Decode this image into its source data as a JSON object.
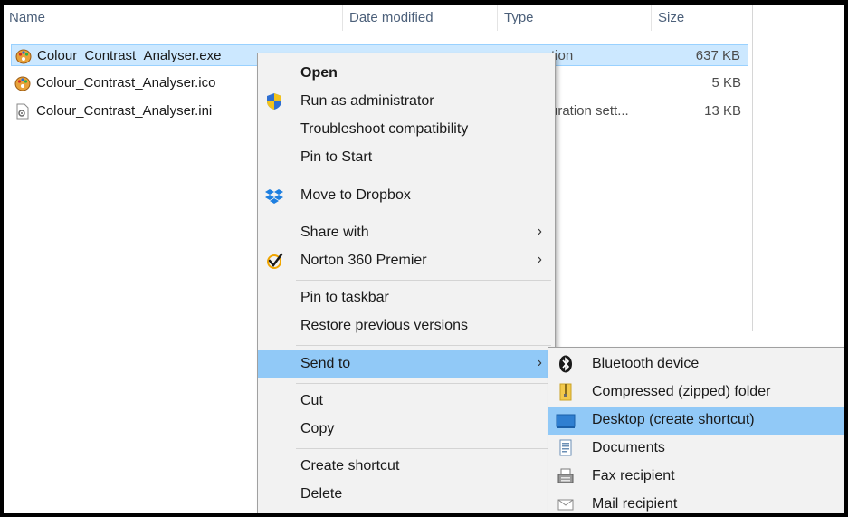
{
  "columns": {
    "name": "Name",
    "date_modified": "Date modified",
    "type": "Type",
    "size": "Size"
  },
  "files": [
    {
      "name": "Colour_Contrast_Analyser.exe",
      "type": "tion",
      "size": "637 KB",
      "icon": "app-palette-icon",
      "selected": true
    },
    {
      "name": "Colour_Contrast_Analyser.ico",
      "type": "",
      "size": "5 KB",
      "icon": "palette-icon",
      "selected": false
    },
    {
      "name": "Colour_Contrast_Analyser.ini",
      "type": "uration sett...",
      "size": "13 KB",
      "icon": "settings-file-icon",
      "selected": false
    }
  ],
  "context_menu": {
    "open": "Open",
    "run_as_admin": "Run as administrator",
    "troubleshoot": "Troubleshoot compatibility",
    "pin_start": "Pin to Start",
    "move_dropbox": "Move to Dropbox",
    "share_with": "Share with",
    "norton": "Norton 360 Premier",
    "pin_taskbar": "Pin to taskbar",
    "restore": "Restore previous versions",
    "send_to": "Send to",
    "cut": "Cut",
    "copy": "Copy",
    "create_shortcut": "Create shortcut",
    "delete": "Delete",
    "submenu_arrow": "›"
  },
  "send_to_menu": {
    "bluetooth": "Bluetooth device",
    "compressed": "Compressed (zipped) folder",
    "desktop": "Desktop (create shortcut)",
    "documents": "Documents",
    "fax": "Fax recipient",
    "mail": "Mail recipient"
  },
  "colors": {
    "selection": "#cce8ff",
    "menu_highlight": "#91c9f7",
    "menu_bg": "#f2f2f2"
  }
}
